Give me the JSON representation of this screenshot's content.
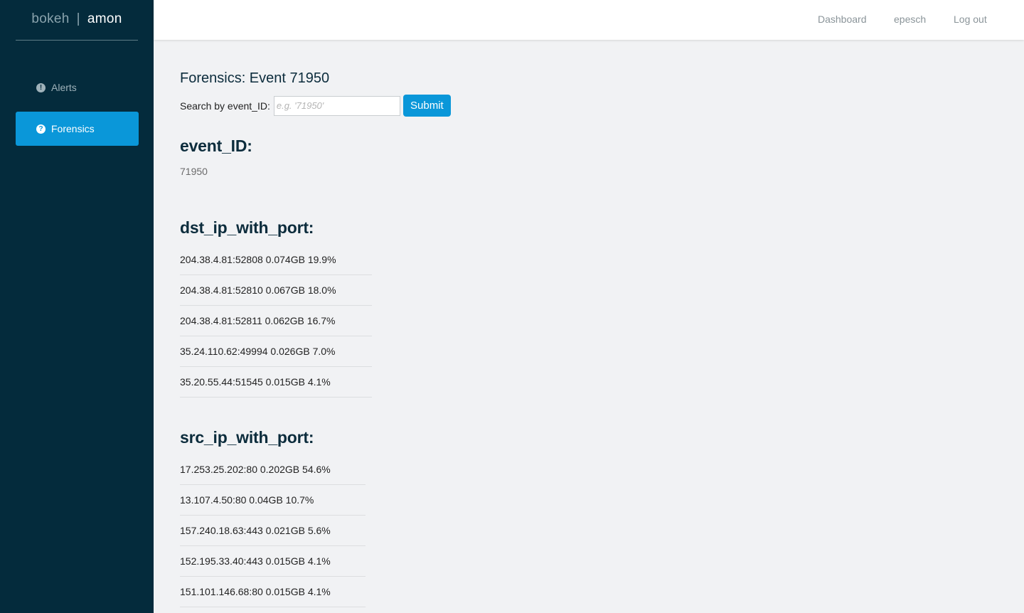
{
  "brand": {
    "left": "bokeh",
    "separator": "|",
    "right": "amon"
  },
  "sidebar": {
    "items": [
      {
        "label": "Alerts",
        "icon": "exclamation-circle-icon",
        "glyph": "!"
      },
      {
        "label": "Forensics",
        "icon": "question-circle-icon",
        "glyph": "?"
      }
    ]
  },
  "topnav": {
    "dashboard": "Dashboard",
    "user": "epesch",
    "logout": "Log out"
  },
  "page": {
    "title": "Forensics: Event 71950"
  },
  "search": {
    "label": "Search by event_ID:",
    "placeholder": "e.g. '71950'",
    "submit": "Submit"
  },
  "event": {
    "heading": "event_ID:",
    "value": "71950"
  },
  "dst": {
    "heading": "dst_ip_with_port:",
    "items": [
      "204.38.4.81:52808 0.074GB 19.9%",
      "204.38.4.81:52810 0.067GB 18.0%",
      "204.38.4.81:52811 0.062GB 16.7%",
      "35.24.110.62:49994 0.026GB 7.0%",
      "35.20.55.44:51545 0.015GB 4.1%"
    ]
  },
  "src": {
    "heading": "src_ip_with_port:",
    "items": [
      "17.253.25.202:80 0.202GB 54.6%",
      "13.107.4.50:80 0.04GB 10.7%",
      "157.240.18.63:443 0.021GB 5.6%",
      "152.195.33.40:443 0.015GB 4.1%",
      "151.101.146.68:80 0.015GB 4.1%"
    ]
  },
  "colors": {
    "sidebar": "#042b3c",
    "accent": "#0a97d9",
    "heading": "#0c2c3c",
    "background": "#f1f2f4"
  }
}
